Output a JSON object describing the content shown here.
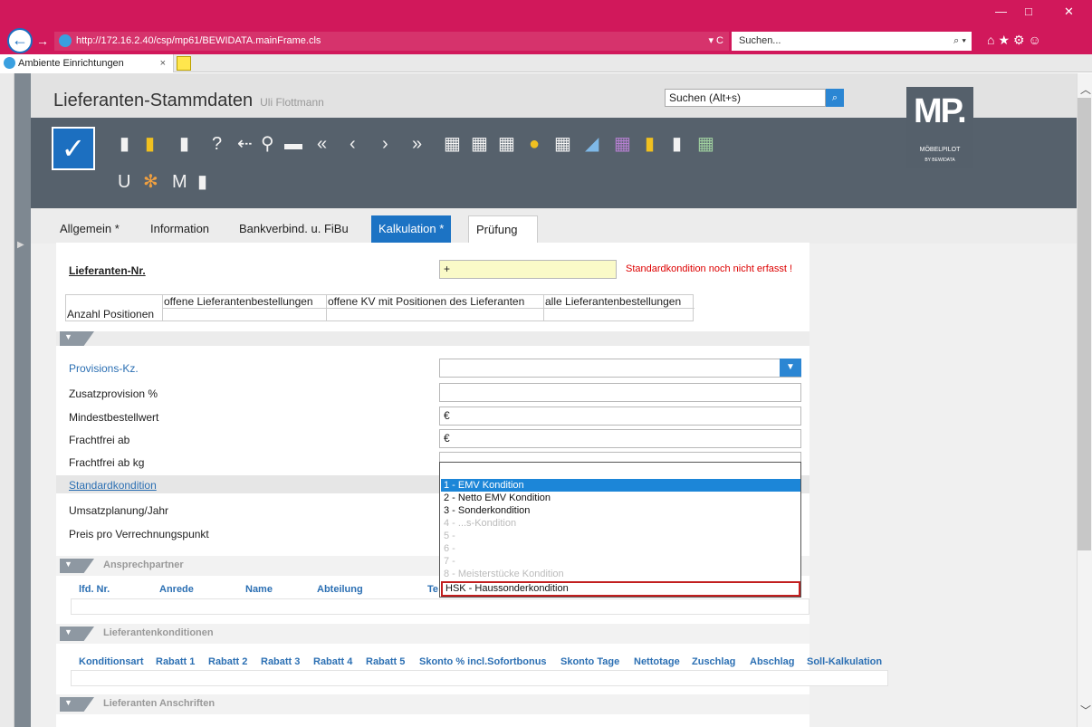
{
  "browser": {
    "url": "http://172.16.2.40/csp/mp61/BEWIDATA.mainFrame.cls",
    "url_controls": "▾ C",
    "search_placeholder": "Suchen...",
    "search_icon": "⌕ ▾",
    "tab_title": "Ambiente Einrichtungen",
    "tab_close": "×",
    "back_glyph": "←",
    "fwd_glyph": "→",
    "win_min": "—",
    "win_max": "□",
    "win_close": "✕",
    "top_icons": "⌂★⚙☺"
  },
  "app": {
    "title": "Lieferanten-Stammdaten",
    "user": "Uli Flottmann",
    "search_placeholder": "Suchen (Alt+s)",
    "search_icon": "⌕",
    "logo_main": "MP.",
    "logo_sub": "MÖBELPILOT",
    "logo_by": "BY BEWIDATA",
    "check_glyph": "✓",
    "toolbar_row2": [
      "U",
      "M"
    ]
  },
  "tabs": [
    {
      "label": "Allgemein *"
    },
    {
      "label": "Information"
    },
    {
      "label": "Bankverbind. u. FiBu"
    },
    {
      "label": "Kalkulation *"
    },
    {
      "label": "Prüfung"
    }
  ],
  "form": {
    "lieferanten_label": "Lieferanten-Nr.",
    "lieferanten_value": "+",
    "warning": "Standardkondition noch nicht erfasst !",
    "stats_headers": [
      "offene Lieferantenbestellungen",
      "offene KV mit Positionen des Lieferanten",
      "alle Lieferantenbestellungen"
    ],
    "stats_row_label": "Anzahl Positionen",
    "rows": [
      {
        "label": "Provisions-Kz.",
        "value": ""
      },
      {
        "label": "Zusatzprovision %",
        "value": ""
      },
      {
        "label": "Mindestbestellwert",
        "value": "€"
      },
      {
        "label": "Frachtfrei ab",
        "value": "€"
      },
      {
        "label": "Frachtfrei ab kg",
        "value": ""
      },
      {
        "label": "Standardkondition",
        "value": ""
      },
      {
        "label": "Umsatzplanung/Jahr",
        "value": ""
      },
      {
        "label": "Preis pro Verrechnungspunkt",
        "value": ""
      }
    ]
  },
  "dropdown": {
    "options": [
      {
        "label": "1 - EMV Kondition",
        "state": "selected"
      },
      {
        "label": "2 - Netto EMV Kondition",
        "state": "normal"
      },
      {
        "label": "3 - Sonderkondition",
        "state": "normal"
      },
      {
        "label": "4 - ...s-Kondition",
        "state": "dim"
      },
      {
        "label": "5 -",
        "state": "dim"
      },
      {
        "label": "6 -",
        "state": "dim"
      },
      {
        "label": "7 -",
        "state": "dim"
      },
      {
        "label": "8 - Meisterstücke Kondition",
        "state": "dim"
      },
      {
        "label": "HSK - Haussonderkondition",
        "state": "highlighted"
      }
    ]
  },
  "sections": {
    "ansprechpartner": {
      "title": "Ansprechpartner",
      "columns": [
        "lfd. Nr.",
        "Anrede",
        "Name",
        "Abteilung",
        "Te"
      ]
    },
    "konditionen": {
      "title": "Lieferantenkonditionen",
      "columns": [
        "Konditionsart",
        "Rabatt 1",
        "Rabatt 2",
        "Rabatt 3",
        "Rabatt 4",
        "Rabatt 5",
        "Skonto % incl.Sofortbonus",
        "Skonto Tage",
        "Nettotage",
        "Zuschlag",
        "Abschlag",
        "Soll-Kalkulation"
      ]
    },
    "anschriften": {
      "title": "Lieferanten Anschriften"
    }
  },
  "colors": {
    "accent": "#d1185b",
    "primary": "#1c73c4",
    "toolbar": "#56616c",
    "warning": "#dd0000"
  }
}
